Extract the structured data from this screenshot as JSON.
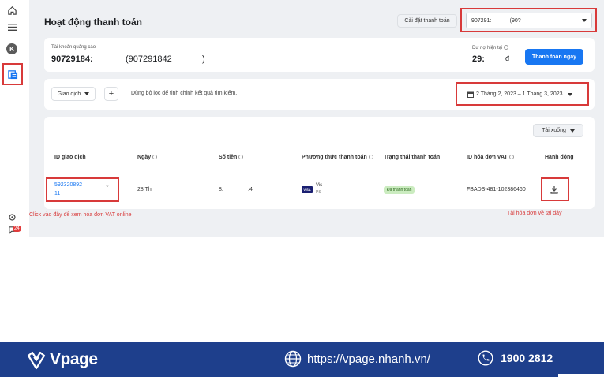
{
  "sidebar": {
    "avatar_letter": "K",
    "notification_count": "24"
  },
  "header": {
    "title": "Hoạt động thanh toán",
    "settings_button": "Cài đặt thanh toán",
    "account_select_value": "907291:            (90?"
  },
  "account": {
    "label": "Tài khoản quảng cáo",
    "id_value": "90729184:",
    "id_paren": "(907291842",
    "id_paren_close": ")",
    "balance_label": "Dư nợ hiện tại",
    "balance_value": "29:",
    "balance_currency": "đ",
    "pay_button": "Thanh toán ngay"
  },
  "filters": {
    "type_select": "Giao dịch",
    "add_button": "+",
    "hint": "Dùng bộ lọc để tinh chỉnh kết quả tìm kiếm.",
    "date_range": "2 Tháng 2, 2023 – 1 Tháng 3, 2023"
  },
  "table": {
    "download_button": "Tải xuống",
    "columns": [
      "ID giao dịch",
      "Ngày",
      "Số tiền",
      "Phương thức thanh toán",
      "Trạng thái thanh toán",
      "ID hóa đơn VAT",
      "Hành động"
    ],
    "row": {
      "transaction_id": "592320892",
      "transaction_id_suffix": "11",
      "date": "28 Th",
      "amount": "8.",
      "amount_suffix": ":4",
      "payment_card": "VISA",
      "payment_name": "Vis",
      "payment_suffix": "PS",
      "status": "Đã thanh toán",
      "vat_id": "FBADS-481-102386460"
    }
  },
  "annotations": {
    "left": "Click vào đây để xem hóa đơn VAT online",
    "right": "Tải hóa đơn về tại đây"
  },
  "footer": {
    "brand": "Vpage",
    "website": "https://vpage.nhanh.vn/",
    "phone": "1900 2812"
  },
  "colors": {
    "highlight": "#d83a3a",
    "primary_button": "#1877f2",
    "footer_bg": "#1e3f8c",
    "status_bg": "#cbecc0"
  }
}
